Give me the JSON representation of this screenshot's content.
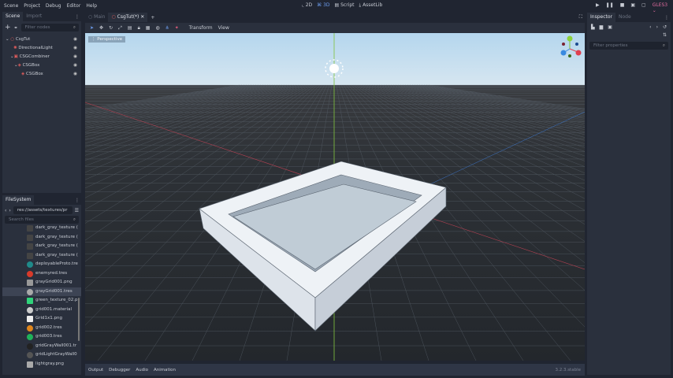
{
  "menu": [
    "Scene",
    "Project",
    "Debug",
    "Editor",
    "Help"
  ],
  "modes": {
    "m2d": "2D",
    "m3d": "3D",
    "script": "Script",
    "assetlib": "AssetLib"
  },
  "renderer": "GLES3",
  "scene_dock": {
    "tabs": [
      "Scene",
      "Import"
    ],
    "filter_placeholder": "Filter nodes",
    "nodes": [
      {
        "name": "CsgTut",
        "depth": 0,
        "color": "#e05c5c"
      },
      {
        "name": "DirectionalLight",
        "depth": 1,
        "color": "#e05c5c"
      },
      {
        "name": "CSGCombiner",
        "depth": 1,
        "color": "#e05c5c"
      },
      {
        "name": "CSGBox",
        "depth": 2,
        "color": "#e05c5c"
      },
      {
        "name": "CSGBox",
        "depth": 3,
        "color": "#e05c5c"
      }
    ]
  },
  "filesystem": {
    "title": "FileSystem",
    "path": "res://assets/textures/pr",
    "search_placeholder": "Search files",
    "files": [
      {
        "name": "dark_gray_texture (",
        "color": "#444"
      },
      {
        "name": "dark_gray_texture (",
        "color": "#444"
      },
      {
        "name": "dark_gray_texture (",
        "color": "#444"
      },
      {
        "name": "dark_gray_texture (",
        "color": "#444"
      },
      {
        "name": "deployableProto.tre",
        "color": "#1f8a8a"
      },
      {
        "name": "enemyred.tres",
        "color": "#d83a2a"
      },
      {
        "name": "grayGrid001.png",
        "color": "#999"
      },
      {
        "name": "grayGrid001.tres",
        "color": "#aaa"
      },
      {
        "name": "green_texture_02.p",
        "color": "#2fd37a"
      },
      {
        "name": "grid001.material",
        "color": "#ccc"
      },
      {
        "name": "Grid1x1.png",
        "color": "#eee"
      },
      {
        "name": "grid002.tres",
        "color": "#e0861c"
      },
      {
        "name": "grid003.tres",
        "color": "#1fb25a"
      },
      {
        "name": "gridGrayWall001.tr",
        "color": "#222"
      },
      {
        "name": "gridLightGrayWall0",
        "color": "#555"
      },
      {
        "name": "lightgray.png",
        "color": "#aaa"
      }
    ]
  },
  "editor_tabs": [
    "Main",
    "CsgTut(*)"
  ],
  "toolbar": {
    "transform": "Transform",
    "view": "View"
  },
  "viewport": {
    "perspective_label": "Perspective"
  },
  "bottom": {
    "tabs": [
      "Output",
      "Debugger",
      "Audio",
      "Animation"
    ],
    "version": "3.2.3.stable"
  },
  "inspector": {
    "tabs": [
      "Inspector",
      "Node"
    ],
    "filter_placeholder": "Filter properties"
  }
}
